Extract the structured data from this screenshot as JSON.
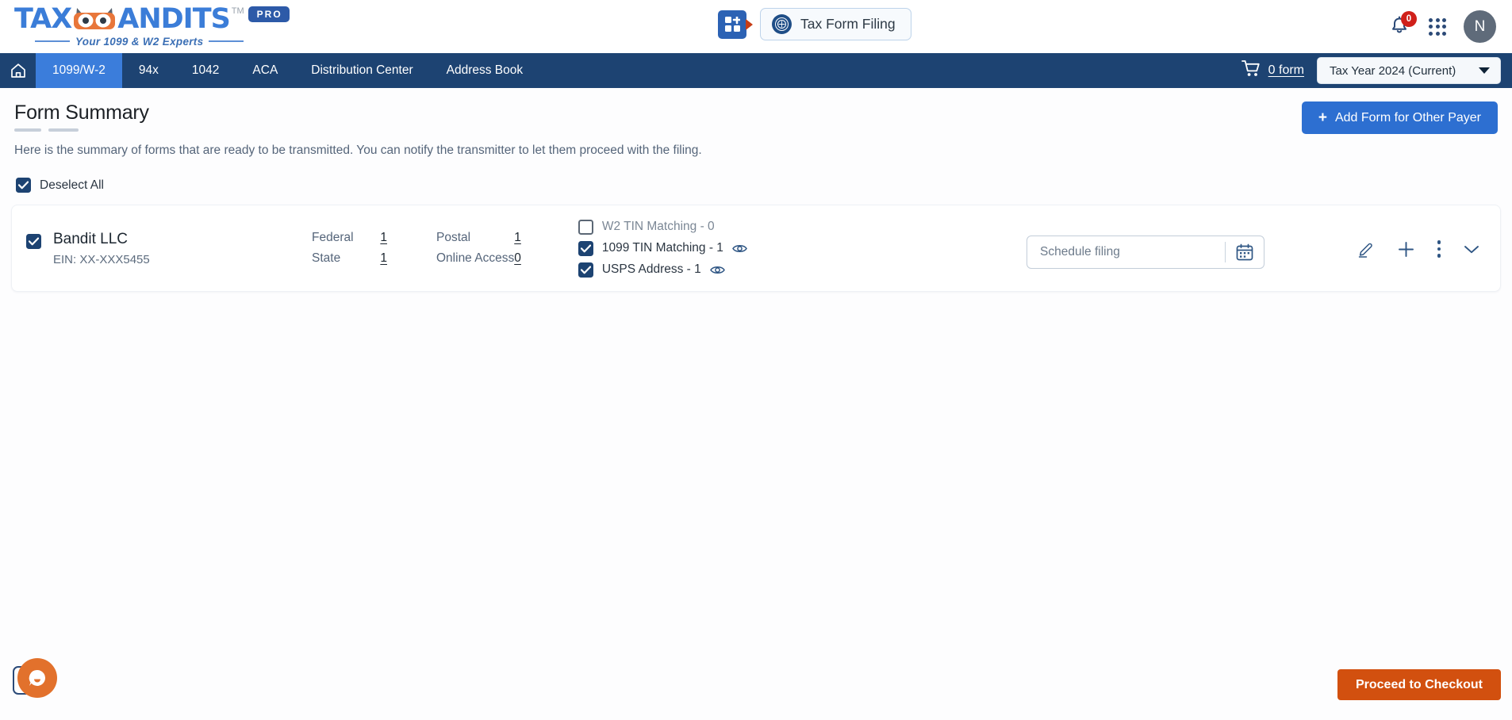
{
  "brand": {
    "logo_text_1": "TAX",
    "logo_text_2": "ANDITS",
    "trademark": "TM",
    "pro_badge": "PRO",
    "tagline": "Your 1099 & W2 Experts"
  },
  "header": {
    "grid_icon": "grid-apps-icon",
    "tax_form_filing_label": "Tax Form Filing",
    "irs_icon": "irs-seal-icon",
    "notification_icon": "bell-icon",
    "notification_count": "0",
    "apps_icon": "apps-grid-icon",
    "avatar_initial": "N"
  },
  "nav": {
    "home_icon": "home-icon",
    "items": [
      {
        "label": "1099/W-2",
        "active": true
      },
      {
        "label": "94x",
        "active": false
      },
      {
        "label": "1042",
        "active": false
      },
      {
        "label": "ACA",
        "active": false
      },
      {
        "label": "Distribution Center",
        "active": false
      },
      {
        "label": "Address Book",
        "active": false
      }
    ],
    "cart_icon": "shopping-cart-icon",
    "cart_label": "0 form",
    "tax_year_value": "Tax Year 2024 (Current)",
    "tax_year_caret": "chevron-down-icon"
  },
  "main": {
    "page_title": "Form Summary",
    "description": "Here is the summary of forms that are ready to be transmitted. You can notify the transmitter to let them proceed with the filing.",
    "add_payer_label": "Add Form for Other Payer",
    "add_payer_plus": "+",
    "deselect_all_label": "Deselect All",
    "deselect_all_checked": true
  },
  "payer": {
    "selected": true,
    "name": "Bandit LLC",
    "ein": "EIN: XX-XXX5455",
    "counts": [
      {
        "label": "Federal",
        "value": "1"
      },
      {
        "label": "Postal",
        "value": "1"
      },
      {
        "label": "State",
        "value": "1"
      },
      {
        "label": "Online Access",
        "value": "0"
      }
    ],
    "matching": [
      {
        "label": "W2 TIN Matching - 0",
        "checked": false,
        "has_eye": false
      },
      {
        "label": "1099 TIN Matching - 1",
        "checked": true,
        "has_eye": true
      },
      {
        "label": "USPS Address - 1",
        "checked": true,
        "has_eye": true
      }
    ],
    "schedule_placeholder": "Schedule filing",
    "schedule_value": "",
    "calendar_icon": "calendar-icon",
    "actions": [
      {
        "icon": "pencil-edit-icon"
      },
      {
        "icon": "plus-add-icon"
      },
      {
        "icon": "more-vertical-icon"
      },
      {
        "icon": "chevron-down-icon"
      }
    ]
  },
  "footer": {
    "chat_icon": "chat-bubble-icon",
    "checkout_label": "Proceed to Checkout"
  },
  "colors": {
    "nav_bg": "#1d4372",
    "nav_active": "#3b7ddb",
    "primary_blue": "#2d6fd1",
    "checkout_orange": "#d2500f",
    "chat_orange": "#e2712c",
    "badge_red": "#d0201a"
  }
}
